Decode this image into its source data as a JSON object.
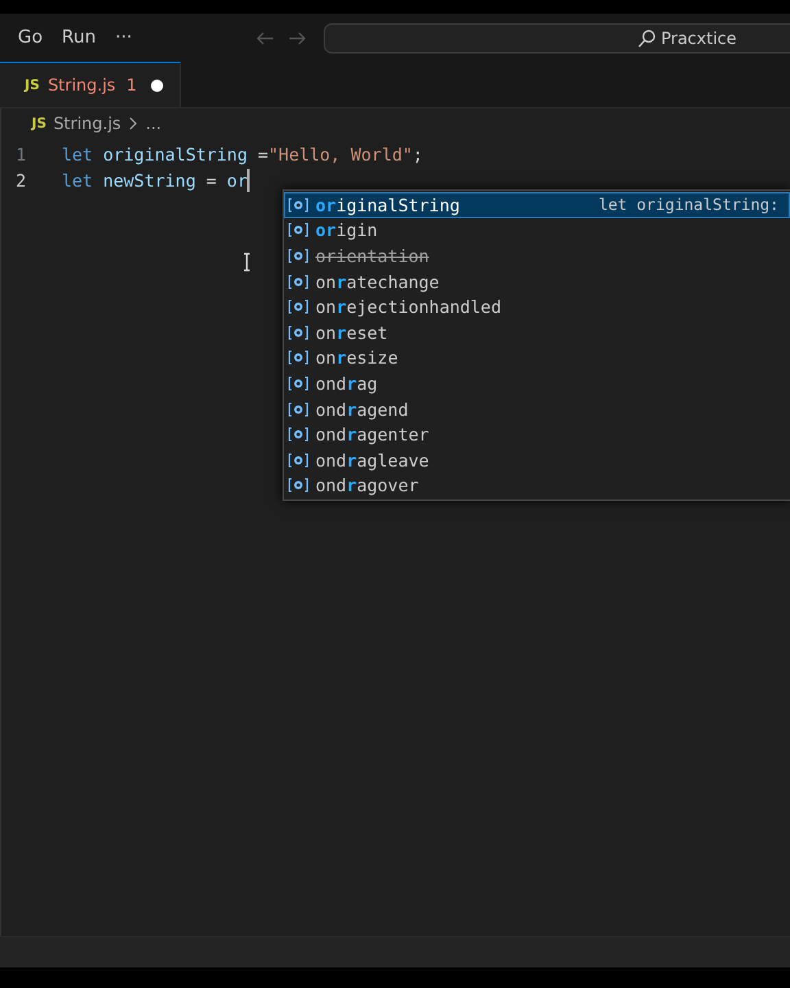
{
  "menu": [
    {
      "label": "Go"
    },
    {
      "label": "Run"
    },
    {
      "label": "···"
    }
  ],
  "command_center": {
    "label": "Pracxtice"
  },
  "tabs": [
    {
      "icon": "JS",
      "label": "String.js",
      "problems": "1",
      "modified": true,
      "selected": true
    }
  ],
  "breadcrumb": {
    "icon": "JS",
    "file": "String.js",
    "more": "..."
  },
  "lines": [
    {
      "number": "1",
      "current": false,
      "tokens": [
        {
          "kind": "keyword",
          "text": "let "
        },
        {
          "kind": "variable",
          "text": "originalString"
        },
        {
          "kind": "plain",
          "text": " ="
        },
        {
          "kind": "string",
          "text": "\"Hello, World\""
        },
        {
          "kind": "plain",
          "text": ";"
        }
      ]
    },
    {
      "number": "2",
      "current": true,
      "tokens": [
        {
          "kind": "keyword",
          "text": "let "
        },
        {
          "kind": "variable",
          "text": "newString"
        },
        {
          "kind": "plain",
          "text": " = "
        },
        {
          "kind": "variable",
          "text": "or"
        }
      ]
    }
  ],
  "suggestions": [
    {
      "parts": [
        {
          "text": "or",
          "match": true
        },
        {
          "text": "iginalString",
          "match": false
        }
      ],
      "selected": true,
      "deprecated": false,
      "detail": "let originalString:"
    },
    {
      "parts": [
        {
          "text": "or",
          "match": true
        },
        {
          "text": "igin",
          "match": false
        }
      ],
      "selected": false,
      "deprecated": false
    },
    {
      "label": "orientation",
      "selected": false,
      "deprecated": true
    },
    {
      "parts": [
        {
          "text": "on",
          "match": false
        },
        {
          "text": "r",
          "match": true
        },
        {
          "text": "atechange",
          "match": false
        }
      ],
      "selected": false,
      "deprecated": false
    },
    {
      "parts": [
        {
          "text": "on",
          "match": false
        },
        {
          "text": "r",
          "match": true
        },
        {
          "text": "ejectionhandled",
          "match": false
        }
      ],
      "selected": false,
      "deprecated": false
    },
    {
      "parts": [
        {
          "text": "on",
          "match": false
        },
        {
          "text": "r",
          "match": true
        },
        {
          "text": "eset",
          "match": false
        }
      ],
      "selected": false,
      "deprecated": false
    },
    {
      "parts": [
        {
          "text": "on",
          "match": false
        },
        {
          "text": "r",
          "match": true
        },
        {
          "text": "esize",
          "match": false
        }
      ],
      "selected": false,
      "deprecated": false
    },
    {
      "parts": [
        {
          "text": "ond",
          "match": false
        },
        {
          "text": "r",
          "match": true
        },
        {
          "text": "ag",
          "match": false
        }
      ],
      "selected": false,
      "deprecated": false
    },
    {
      "parts": [
        {
          "text": "ond",
          "match": false
        },
        {
          "text": "r",
          "match": true
        },
        {
          "text": "agend",
          "match": false
        }
      ],
      "selected": false,
      "deprecated": false
    },
    {
      "parts": [
        {
          "text": "ond",
          "match": false
        },
        {
          "text": "r",
          "match": true
        },
        {
          "text": "agenter",
          "match": false
        }
      ],
      "selected": false,
      "deprecated": false
    },
    {
      "parts": [
        {
          "text": "ond",
          "match": false
        },
        {
          "text": "r",
          "match": true
        },
        {
          "text": "agleave",
          "match": false
        }
      ],
      "selected": false,
      "deprecated": false
    },
    {
      "parts": [
        {
          "text": "ond",
          "match": false
        },
        {
          "text": "r",
          "match": true
        },
        {
          "text": "agover",
          "match": false
        }
      ],
      "selected": false,
      "deprecated": false
    }
  ]
}
